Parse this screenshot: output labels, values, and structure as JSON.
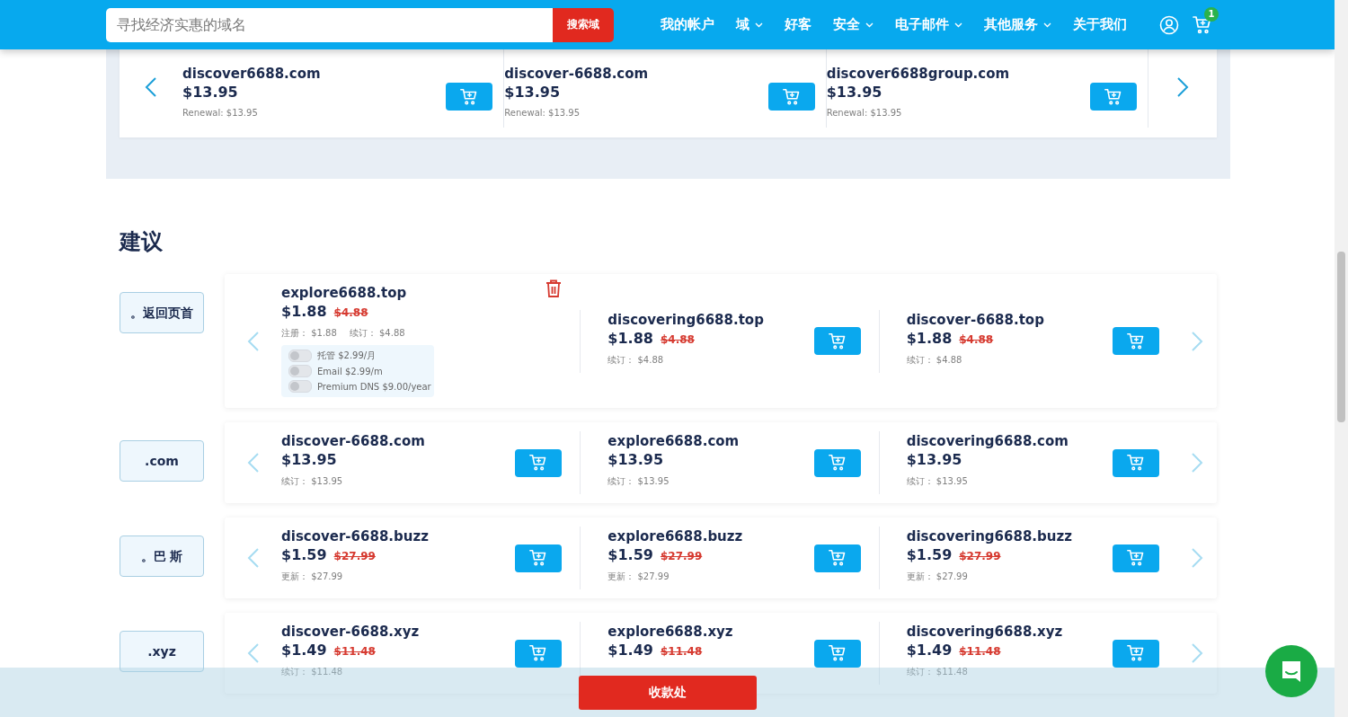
{
  "header": {
    "search": {
      "placeholder": "寻找经济实惠的域名"
    },
    "search_button": "搜索域",
    "nav": [
      {
        "label": "我的帐户",
        "dropdown": false
      },
      {
        "label": "域",
        "dropdown": true
      },
      {
        "label": "好客",
        "dropdown": false
      },
      {
        "label": "安全",
        "dropdown": true
      },
      {
        "label": "电子邮件",
        "dropdown": true
      },
      {
        "label": "其他服务",
        "dropdown": true
      },
      {
        "label": "关于我们",
        "dropdown": false
      }
    ],
    "cart_count": "1"
  },
  "top_carousel": {
    "items": [
      {
        "domain": "discover6688.com",
        "price": "$13.95",
        "renewal": "Renewal: $13.95"
      },
      {
        "domain": "discover-6688.com",
        "price": "$13.95",
        "renewal": "Renewal: $13.95"
      },
      {
        "domain": "discover6688group.com",
        "price": "$13.95",
        "renewal": "Renewal: $13.95"
      }
    ]
  },
  "suggestions": {
    "title": "建议",
    "groups": [
      {
        "label": "。返回页首",
        "items": [
          {
            "domain": "explore6688.top",
            "price": "$1.88",
            "old_price": "$4.88",
            "in_cart": true,
            "details": [
              "注册： $1.88",
              "续订： $4.88"
            ],
            "addons": [
              {
                "label": "托管 $2.99/月",
                "on": false
              },
              {
                "label": "Email $2.99/m",
                "on": false
              },
              {
                "label": "Premium DNS $9.00/year",
                "on": false
              }
            ]
          },
          {
            "domain": "discovering6688.top",
            "price": "$1.88",
            "old_price": "$4.88",
            "in_cart": false,
            "details": [
              "续订： $4.88"
            ]
          },
          {
            "domain": "discover-6688.top",
            "price": "$1.88",
            "old_price": "$4.88",
            "in_cart": false,
            "details": [
              "续订： $4.88"
            ]
          }
        ]
      },
      {
        "label": ".com",
        "items": [
          {
            "domain": "discover-6688.com",
            "price": "$13.95",
            "in_cart": false,
            "details": [
              "续订： $13.95"
            ]
          },
          {
            "domain": "explore6688.com",
            "price": "$13.95",
            "in_cart": false,
            "details": [
              "续订： $13.95"
            ]
          },
          {
            "domain": "discovering6688.com",
            "price": "$13.95",
            "in_cart": false,
            "details": [
              "续订： $13.95"
            ]
          }
        ]
      },
      {
        "label": "。巴 斯",
        "items": [
          {
            "domain": "discover-6688.buzz",
            "price": "$1.59",
            "old_price": "$27.99",
            "in_cart": false,
            "details": [
              "更新： $27.99"
            ]
          },
          {
            "domain": "explore6688.buzz",
            "price": "$1.59",
            "old_price": "$27.99",
            "in_cart": false,
            "details": [
              "更新： $27.99"
            ]
          },
          {
            "domain": "discovering6688.buzz",
            "price": "$1.59",
            "old_price": "$27.99",
            "in_cart": false,
            "details": [
              "更新： $27.99"
            ]
          }
        ]
      },
      {
        "label": ".xyz",
        "items": [
          {
            "domain": "discover-6688.xyz",
            "price": "$1.49",
            "old_price": "$11.48",
            "in_cart": false,
            "details": [
              "续订： $11.48"
            ]
          },
          {
            "domain": "explore6688.xyz",
            "price": "$1.49",
            "old_price": "$11.48",
            "in_cart": false
          },
          {
            "domain": "discovering6688.xyz",
            "price": "$1.49",
            "old_price": "$11.48",
            "in_cart": false,
            "details": [
              "续订： $11.48"
            ]
          }
        ]
      }
    ]
  },
  "checkout_button": "收款处"
}
